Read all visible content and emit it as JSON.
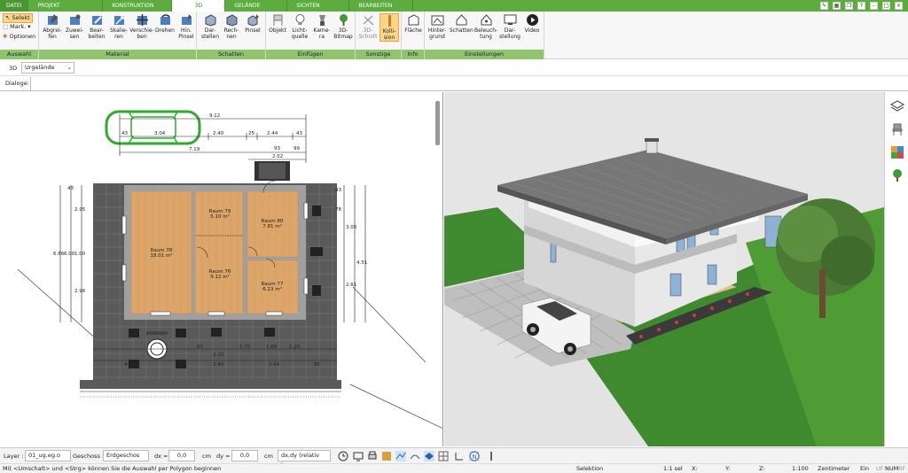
{
  "menu": {
    "tabs": [
      "DATEI",
      "PROJEKT",
      "KONSTRUKTION",
      "3D",
      "GELÄNDE",
      "SICHTEN",
      "BEARBEITEN"
    ],
    "active_tab": "3D"
  },
  "ribbon": {
    "auswahl": {
      "label": "Auswahl",
      "items": [
        "Selekt",
        "Mark.",
        "Optionen"
      ]
    },
    "material": {
      "label": "Material",
      "buttons": [
        "Abgrei-fen",
        "Zuwei-sen",
        "Bear-beiten",
        "Skalie-ren",
        "Verschie-ben",
        "Drehen",
        "Hin. Pinsel"
      ]
    },
    "schatten": {
      "label": "Schatten",
      "buttons": [
        "Dar-stellen",
        "Rech-nen",
        "Pinsel"
      ]
    },
    "einfuegen": {
      "label": "Einfügen",
      "buttons": [
        "Objekt",
        "Licht-quelle",
        "Kame-ra",
        "3D-Bitmap"
      ]
    },
    "sonstige": {
      "label": "Sonstige",
      "buttons": [
        "3D-Schnitt",
        "Kolli-sion"
      ]
    },
    "info": {
      "label": "Info",
      "buttons": [
        "Fläche"
      ]
    },
    "einstellungen": {
      "label": "Einstellungen",
      "buttons": [
        "Hinter-grund",
        "Schatten",
        "Beleuch-tung",
        "Dar-stellung",
        "Video"
      ]
    }
  },
  "view_selector": {
    "mode": "3D",
    "value": "Urgelände"
  },
  "dialoge_label": "Dialoge:",
  "plan": {
    "rooms": [
      {
        "name": "Raum 78",
        "area": "18.01 m²"
      },
      {
        "name": "Raum 79",
        "area": "5.10 m²"
      },
      {
        "name": "Raum 80",
        "area": "7.81 m²"
      },
      {
        "name": "Raum 76",
        "area": "9.12 m²"
      },
      {
        "name": "Raum 77",
        "area": "6.23 m²"
      }
    ],
    "dims_top": [
      "9.12",
      "2.40",
      "25",
      "2.44",
      "43",
      "7.19",
      "93",
      "99",
      "2.02",
      "43",
      "3.04"
    ],
    "dims_side": [
      "6.86",
      "6.00",
      "2.95",
      "1.00",
      "2.96",
      "43",
      "3.00",
      "2.61",
      "4.51",
      "78",
      "43"
    ],
    "dims_bottom": [
      "2.10",
      "1.75",
      "1.69",
      "1.20",
      "2.40",
      "2.44",
      "43",
      "85",
      "85"
    ]
  },
  "status": {
    "layer_label": "Layer :",
    "layer_value": "01_ug.eg.o",
    "geschoss_label": "Geschoss :",
    "geschoss_value": "Erdgeschos",
    "dx_label": "dx =",
    "dx_value": "0,0",
    "dx_unit": "cm",
    "dy_label": "dy =",
    "dy_value": "0,0",
    "dy_unit": "cm",
    "mode_value": "dx,dy (relativ ka"
  },
  "hint": {
    "text": "Mit <Umschalt> und <Strg> können Sie die Auswahl per Polygon beginnen",
    "mode": "Selektion",
    "sel": "1:1 sel",
    "x": "X:",
    "y": "Y:",
    "z": "Z:",
    "scale": "1:100",
    "unit": "Zentimeter",
    "ein": "Ein",
    "uf": "UF",
    "num": "NUM",
    "rf": "RF"
  },
  "colors": {
    "brand": "#5cad3e",
    "group_label": "#8fc66c",
    "active": "#fbd58a"
  },
  "icons": [
    "layers-icon",
    "chair-icon",
    "palette-icon",
    "tree-icon"
  ]
}
